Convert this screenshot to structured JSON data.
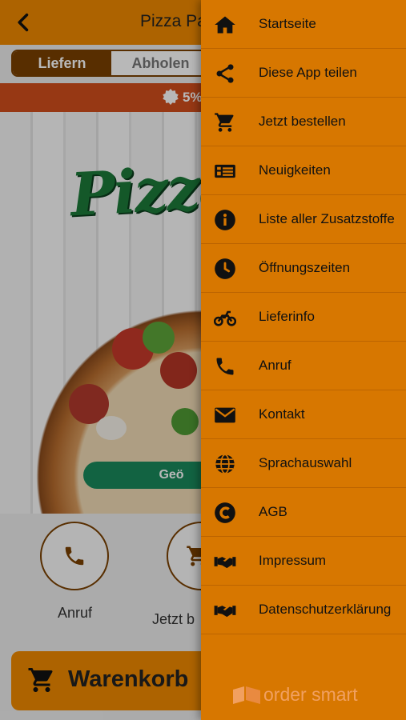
{
  "app": {
    "title": "Pizza Pa",
    "delivery_toggle": {
      "deliver": "Liefern",
      "pickup": "Abholen"
    },
    "promo": "5%",
    "hero_logo": "Pizza",
    "hero_button": "Geö",
    "actions": [
      {
        "label": "Anruf",
        "icon": "phone-icon"
      },
      {
        "label": "Jetzt b",
        "icon": "cart-icon"
      }
    ],
    "cart_button": "Warenkorb"
  },
  "drawer": {
    "items": [
      {
        "label": "Startseite",
        "icon": "home-icon"
      },
      {
        "label": "Diese App teilen",
        "icon": "share-icon"
      },
      {
        "label": "Jetzt bestellen",
        "icon": "cart-icon"
      },
      {
        "label": "Neuigkeiten",
        "icon": "newspaper-icon"
      },
      {
        "label": "Liste aller Zusatzstoffe",
        "icon": "info-icon"
      },
      {
        "label": "Öffnungszeiten",
        "icon": "clock-icon"
      },
      {
        "label": "Lieferinfo",
        "icon": "motorcycle-icon"
      },
      {
        "label": "Anruf",
        "icon": "phone-icon"
      },
      {
        "label": "Kontakt",
        "icon": "envelope-icon"
      },
      {
        "label": "Sprachauswahl",
        "icon": "globe-icon"
      },
      {
        "label": "AGB",
        "icon": "copyright-icon"
      },
      {
        "label": "Impressum",
        "icon": "handshake-icon"
      },
      {
        "label": "Datenschutzerklärung",
        "icon": "handshake-icon"
      }
    ],
    "brand": "order smart"
  },
  "colors": {
    "topbar": "#f08a00",
    "drawer": "#d77700",
    "toggle_active": "#7a4100",
    "promo": "#d24e1c",
    "hero_button": "#1a8a5c"
  }
}
